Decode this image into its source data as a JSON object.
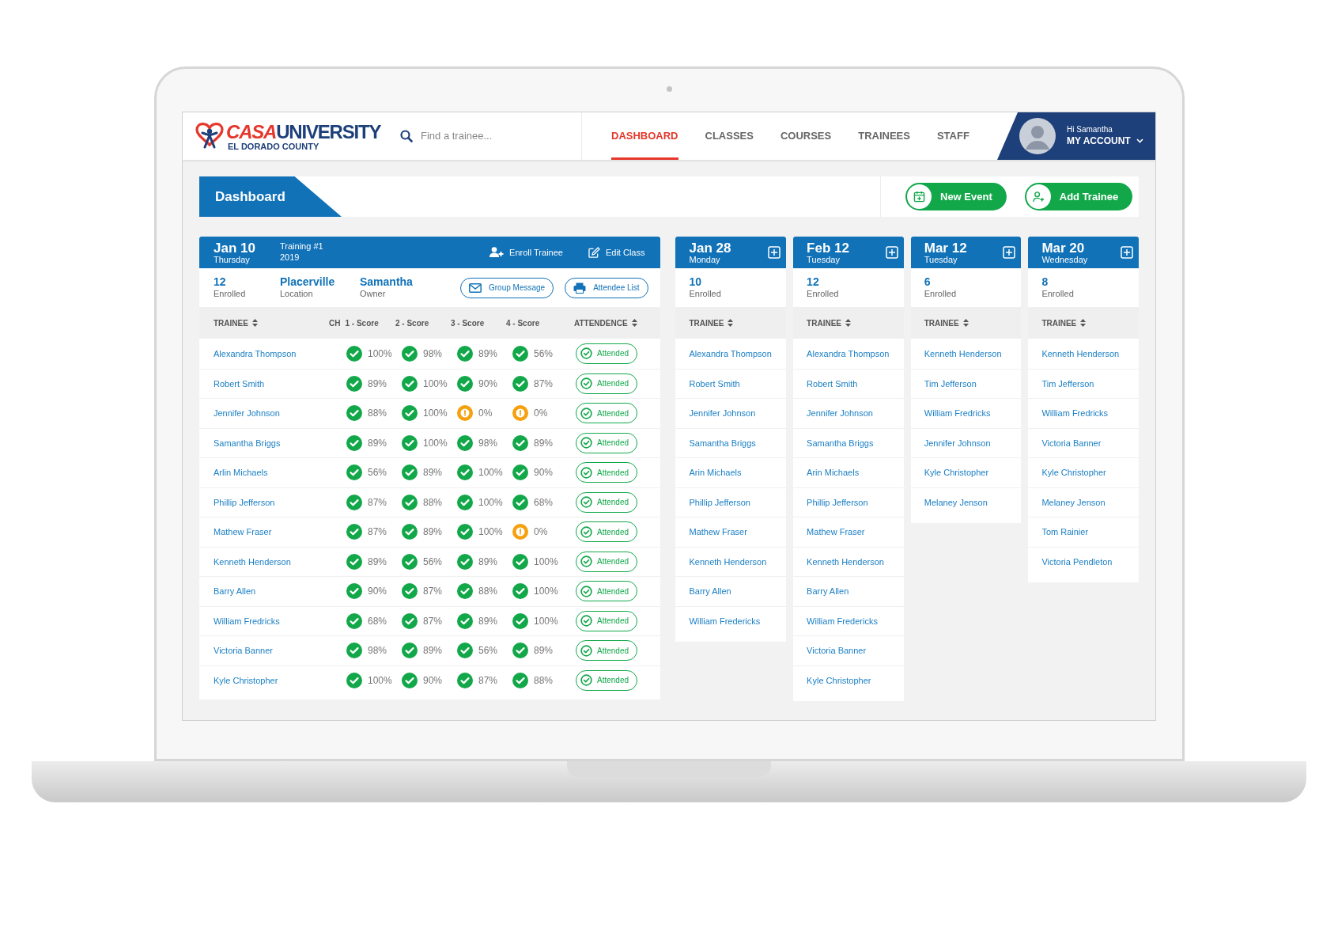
{
  "header": {
    "logo": {
      "part1": "CASA",
      "part2": "UNIVERSITY",
      "subtitle": "EL DORADO COUNTY"
    },
    "search": {
      "placeholder": "Find a trainee..."
    },
    "nav": [
      {
        "label": "DASHBOARD",
        "selected": true
      },
      {
        "label": "CLASSES",
        "selected": false
      },
      {
        "label": "COURSES",
        "selected": false
      },
      {
        "label": "TRAINEES",
        "selected": false
      },
      {
        "label": "STAFF",
        "selected": false
      }
    ],
    "account": {
      "greeting": "Hi Samantha",
      "label": "MY ACCOUNT"
    }
  },
  "page_title": "Dashboard",
  "actions": [
    {
      "label": "New Event",
      "kind": "event"
    },
    {
      "label": "Add Trainee",
      "kind": "trainee"
    }
  ],
  "main_class": {
    "date": "Jan 10",
    "weekday": "Thursday",
    "title": "Training #1",
    "year": "2019",
    "header_actions": [
      {
        "label": "Enroll Trainee",
        "kind": "enroll"
      },
      {
        "label": "Edit Class",
        "kind": "edit"
      }
    ],
    "stats": [
      {
        "value": "12",
        "label": "Enrolled"
      },
      {
        "value": "Placerville",
        "label": "Location"
      },
      {
        "value": "Samantha",
        "label": "Owner"
      }
    ],
    "buttons": [
      {
        "label": "Group Message",
        "kind": "message"
      },
      {
        "label": "Attendee List",
        "kind": "print"
      }
    ],
    "columns": [
      {
        "label": "TRAINEE",
        "sortable": true
      },
      {
        "label": "CH",
        "sortable": false
      },
      {
        "label": "1 - Score",
        "sortable": false
      },
      {
        "label": "2 - Score",
        "sortable": false
      },
      {
        "label": "3 - Score",
        "sortable": false
      },
      {
        "label": "4 - Score",
        "sortable": false
      },
      {
        "label": "ATTENDENCE",
        "sortable": true
      }
    ],
    "rows": [
      {
        "name": "Alexandra Thompson",
        "scores": [
          {
            "value": "100%",
            "kind": "ok"
          },
          {
            "value": "98%",
            "kind": "ok"
          },
          {
            "value": "89%",
            "kind": "ok"
          },
          {
            "value": "56%",
            "kind": "ok"
          }
        ],
        "attendance": "Attended"
      },
      {
        "name": "Robert Smith",
        "scores": [
          {
            "value": "89%",
            "kind": "ok"
          },
          {
            "value": "100%",
            "kind": "ok"
          },
          {
            "value": "90%",
            "kind": "ok"
          },
          {
            "value": "87%",
            "kind": "ok"
          }
        ],
        "attendance": "Attended"
      },
      {
        "name": "Jennifer Johnson",
        "scores": [
          {
            "value": "88%",
            "kind": "ok"
          },
          {
            "value": "100%",
            "kind": "ok"
          },
          {
            "value": "0%",
            "kind": "warning"
          },
          {
            "value": "0%",
            "kind": "warning"
          }
        ],
        "attendance": "Attended"
      },
      {
        "name": "Samantha Briggs",
        "scores": [
          {
            "value": "89%",
            "kind": "ok"
          },
          {
            "value": "100%",
            "kind": "ok"
          },
          {
            "value": "98%",
            "kind": "ok"
          },
          {
            "value": "89%",
            "kind": "ok"
          }
        ],
        "attendance": "Attended"
      },
      {
        "name": "Arlin Michaels",
        "scores": [
          {
            "value": "56%",
            "kind": "ok"
          },
          {
            "value": "89%",
            "kind": "ok"
          },
          {
            "value": "100%",
            "kind": "ok"
          },
          {
            "value": "90%",
            "kind": "ok"
          }
        ],
        "attendance": "Attended"
      },
      {
        "name": "Phillip Jefferson",
        "scores": [
          {
            "value": "87%",
            "kind": "ok"
          },
          {
            "value": "88%",
            "kind": "ok"
          },
          {
            "value": "100%",
            "kind": "ok"
          },
          {
            "value": "68%",
            "kind": "ok"
          }
        ],
        "attendance": "Attended"
      },
      {
        "name": "Mathew Fraser",
        "scores": [
          {
            "value": "87%",
            "kind": "ok"
          },
          {
            "value": "89%",
            "kind": "ok"
          },
          {
            "value": "100%",
            "kind": "ok"
          },
          {
            "value": "0%",
            "kind": "warning"
          }
        ],
        "attendance": "Attended"
      },
      {
        "name": "Kenneth Henderson",
        "scores": [
          {
            "value": "89%",
            "kind": "ok"
          },
          {
            "value": "56%",
            "kind": "ok"
          },
          {
            "value": "89%",
            "kind": "ok"
          },
          {
            "value": "100%",
            "kind": "ok"
          }
        ],
        "attendance": "Attended"
      },
      {
        "name": "Barry Allen",
        "scores": [
          {
            "value": "90%",
            "kind": "ok"
          },
          {
            "value": "87%",
            "kind": "ok"
          },
          {
            "value": "88%",
            "kind": "ok"
          },
          {
            "value": "100%",
            "kind": "ok"
          }
        ],
        "attendance": "Attended"
      },
      {
        "name": "William Fredricks",
        "scores": [
          {
            "value": "68%",
            "kind": "ok"
          },
          {
            "value": "87%",
            "kind": "ok"
          },
          {
            "value": "89%",
            "kind": "ok"
          },
          {
            "value": "100%",
            "kind": "ok"
          }
        ],
        "attendance": "Attended"
      },
      {
        "name": "Victoria Banner",
        "scores": [
          {
            "value": "98%",
            "kind": "ok"
          },
          {
            "value": "89%",
            "kind": "ok"
          },
          {
            "value": "56%",
            "kind": "ok"
          },
          {
            "value": "89%",
            "kind": "ok"
          }
        ],
        "attendance": "Attended"
      },
      {
        "name": "Kyle Christopher",
        "scores": [
          {
            "value": "100%",
            "kind": "ok"
          },
          {
            "value": "90%",
            "kind": "ok"
          },
          {
            "value": "87%",
            "kind": "ok"
          },
          {
            "value": "88%",
            "kind": "ok"
          }
        ],
        "attendance": "Attended"
      }
    ]
  },
  "other_classes": [
    {
      "date": "Jan 28",
      "weekday": "Monday",
      "enrolled": "10",
      "enrolled_label": "Enrolled",
      "column": "TRAINEE",
      "trainees": [
        "Alexandra Thompson",
        "Robert Smith",
        "Jennifer Johnson",
        "Samantha Briggs",
        "Arin Michaels",
        "Phillip Jefferson",
        "Mathew Fraser",
        "Kenneth Henderson",
        "Barry Allen",
        "William Fredericks"
      ]
    },
    {
      "date": "Feb 12",
      "weekday": "Tuesday",
      "enrolled": "12",
      "enrolled_label": "Enrolled",
      "column": "TRAINEE",
      "trainees": [
        "Alexandra Thompson",
        "Robert Smith",
        "Jennifer Johnson",
        "Samantha Briggs",
        "Arin Michaels",
        "Phillip Jefferson",
        "Mathew Fraser",
        "Kenneth Henderson",
        "Barry Allen",
        "William Fredericks",
        "Victoria Banner",
        "Kyle Christopher"
      ]
    },
    {
      "date": "Mar 12",
      "weekday": "Tuesday",
      "enrolled": "6",
      "enrolled_label": "Enrolled",
      "column": "TRAINEE",
      "trainees": [
        "Kenneth Henderson",
        "Tim Jefferson",
        "William Fredricks",
        "Jennifer Johnson",
        "Kyle Christopher",
        "Melaney Jenson"
      ]
    },
    {
      "date": "Mar 20",
      "weekday": "Wednesday",
      "enrolled": "8",
      "enrolled_label": "Enrolled",
      "column": "TRAINEE",
      "trainees": [
        "Kenneth Henderson",
        "Tim Jefferson",
        "William Fredricks",
        "Victoria Banner",
        "Kyle Christopher",
        "Melaney Jenson",
        "Tom Rainier",
        "Victoria Pendleton"
      ]
    }
  ]
}
